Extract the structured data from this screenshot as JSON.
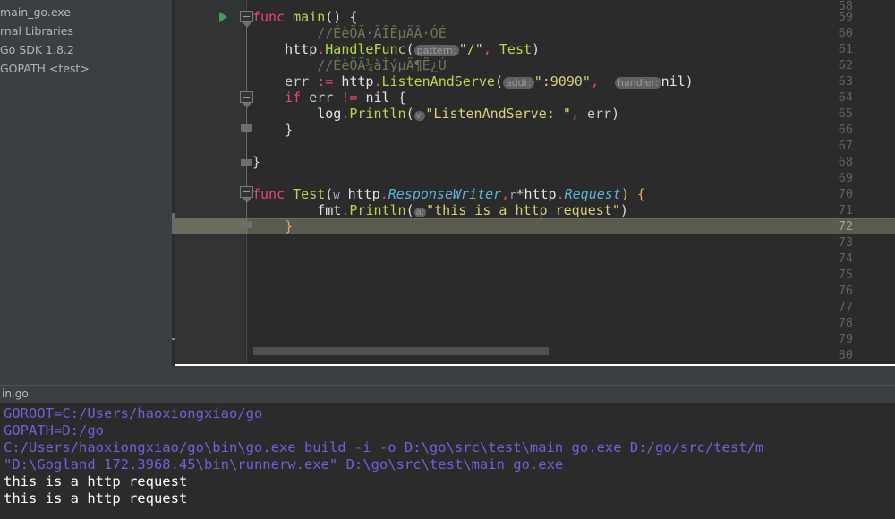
{
  "window": {
    "theme": "darcula",
    "accent_run": "#499c54",
    "keyword_color": "#e8476f",
    "string_color": "#d9d07a",
    "function_color": "#b5d94b",
    "type_color": "#5cb3d9",
    "comment_color": "#6a7a5a",
    "console_cmd_color": "#6d62d9"
  },
  "sidebar": {
    "name": "project-tree",
    "items": [
      {
        "label": "main_go.exe",
        "icon": "file-exe-icon"
      },
      {
        "label": "rnal Libraries",
        "icon": "library-icon"
      },
      {
        "label": "Go SDK 1.8.2",
        "icon": "sdk-icon"
      },
      {
        "label": "GOPATH <test>",
        "icon": "folder-icon"
      }
    ]
  },
  "editor": {
    "name": "code-editor",
    "language": "go",
    "current_line": 72,
    "first_visible_line": 58,
    "last_visible_line": 80,
    "gutter_lines": [
      "58",
      "59",
      "60",
      "61",
      "62",
      "63",
      "64",
      "65",
      "66",
      "67",
      "68",
      "69",
      "70",
      "71",
      "72",
      "73",
      "74",
      "75",
      "76",
      "77",
      "78",
      "79",
      "80"
    ],
    "lines": {
      "l59": {
        "kw": "func",
        "name": "main",
        "rest": "() {"
      },
      "l60": {
        "comment": "//ÉèÖÃ·ÃÎÊµÄÂ·ÓÉ"
      },
      "l61": {
        "pkg": "http",
        "call": "HandleFunc",
        "hint": "pattern:",
        "arg1": "\"/\"",
        "arg2": "Test"
      },
      "l62": {
        "comment": "//ÉèÖÃ¼àÌýµÄ¶Ë¿Ú"
      },
      "l63": {
        "var": "err",
        "op": ":=",
        "pkg": "http",
        "call": "ListenAndServe",
        "hint1": "addr:",
        "arg1": "\":9090\"",
        "hint2": "handler:",
        "arg2": "nil"
      },
      "l64": {
        "kw": "if",
        "var": "err",
        "op": "!=",
        "nil": "nil",
        "brace": "{"
      },
      "l65": {
        "pkg": "log",
        "call": "Println",
        "hint": "v:",
        "arg1": "\"ListenAndServe: \"",
        "arg2": "err"
      },
      "l66": {
        "brace": "}"
      },
      "l68": {
        "brace": "}"
      },
      "l70": {
        "kw": "func",
        "name": "Test",
        "p1": "w",
        "t1pkg": "http",
        "t1": "ResponseWriter",
        "p2": "r",
        "t2pkg": "http",
        "t2": "Request",
        "tail": ") {"
      },
      "l71": {
        "pkg": "fmt",
        "call": "Println",
        "hint": "a:",
        "arg1": "\"this is a http request\""
      },
      "l72": {
        "brace": "}"
      }
    }
  },
  "console": {
    "name": "run-tool-window",
    "tab_label": "in.go",
    "output": [
      {
        "text": "GOROOT=C:/Users/haoxiongxiao/go",
        "kind": "cmd"
      },
      {
        "text": "GOPATH=D:/go",
        "kind": "cmd"
      },
      {
        "text": "C:/Users/haoxiongxiao/go\\bin\\go.exe build -i -o D:\\go\\src\\test\\main_go.exe D:/go/src/test/m",
        "kind": "cmd"
      },
      {
        "text": "\"D:\\Gogland 172.3968.45\\bin\\runnerw.exe\" D:\\go\\src\\test\\main_go.exe",
        "kind": "cmd"
      },
      {
        "text": "this is a http request",
        "kind": "std"
      },
      {
        "text": "this is a http request",
        "kind": "std"
      }
    ]
  }
}
